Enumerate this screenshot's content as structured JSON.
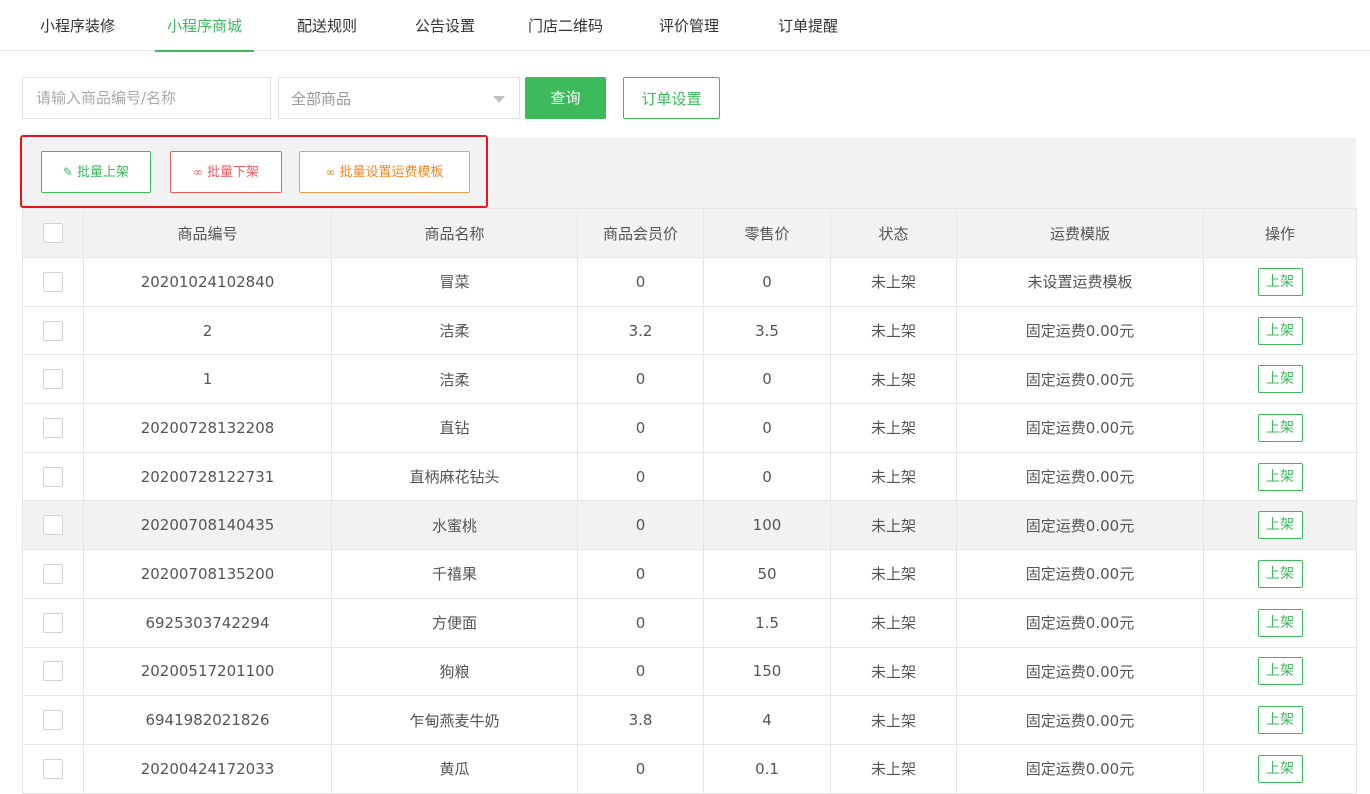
{
  "tabs": [
    {
      "label": "小程序装修"
    },
    {
      "label": "小程序商城"
    },
    {
      "label": "配送规则"
    },
    {
      "label": "公告设置"
    },
    {
      "label": "门店二维码"
    },
    {
      "label": "评价管理"
    },
    {
      "label": "订单提醒"
    }
  ],
  "active_tab": "小程序商城",
  "filters": {
    "search_placeholder": "请输入商品编号/名称",
    "search_value": "",
    "category_selected": "全部商品",
    "query_label": "查询",
    "order_settings_label": "订单设置"
  },
  "toolbar": {
    "batch_up_label": "批量上架",
    "batch_down_label": "批量下架",
    "batch_shipping_label": "批量设置运费模板"
  },
  "table": {
    "headers": [
      "商品编号",
      "商品名称",
      "商品会员价",
      "零售价",
      "状态",
      "运费模版",
      "操作"
    ],
    "rows": [
      {
        "code": "20201024102840",
        "name": "冒菜",
        "member_price": "0",
        "retail_price": "0",
        "status": "未上架",
        "shipping": "未设置运费模板",
        "action": "上架"
      },
      {
        "code": "2",
        "name": "洁柔",
        "member_price": "3.2",
        "retail_price": "3.5",
        "status": "未上架",
        "shipping": "固定运费0.00元",
        "action": "上架"
      },
      {
        "code": "1",
        "name": "洁柔",
        "member_price": "0",
        "retail_price": "0",
        "status": "未上架",
        "shipping": "固定运费0.00元",
        "action": "上架"
      },
      {
        "code": "20200728132208",
        "name": "直钻",
        "member_price": "0",
        "retail_price": "0",
        "status": "未上架",
        "shipping": "固定运费0.00元",
        "action": "上架"
      },
      {
        "code": "20200728122731",
        "name": "直柄麻花钻头",
        "member_price": "0",
        "retail_price": "0",
        "status": "未上架",
        "shipping": "固定运费0.00元",
        "action": "上架"
      },
      {
        "code": "20200708140435",
        "name": "水蜜桃",
        "member_price": "0",
        "retail_price": "100",
        "status": "未上架",
        "shipping": "固定运费0.00元",
        "action": "上架"
      },
      {
        "code": "20200708135200",
        "name": "千禧果",
        "member_price": "0",
        "retail_price": "50",
        "status": "未上架",
        "shipping": "固定运费0.00元",
        "action": "上架"
      },
      {
        "code": "6925303742294",
        "name": "方便面",
        "member_price": "0",
        "retail_price": "1.5",
        "status": "未上架",
        "shipping": "固定运费0.00元",
        "action": "上架"
      },
      {
        "code": "20200517201100",
        "name": "狗粮",
        "member_price": "0",
        "retail_price": "150",
        "status": "未上架",
        "shipping": "固定运费0.00元",
        "action": "上架"
      },
      {
        "code": "6941982021826",
        "name": "乍甸燕麦牛奶",
        "member_price": "3.8",
        "retail_price": "4",
        "status": "未上架",
        "shipping": "固定运费0.00元",
        "action": "上架"
      },
      {
        "code": "20200424172033",
        "name": "黄瓜",
        "member_price": "0",
        "retail_price": "0.1",
        "status": "未上架",
        "shipping": "固定运费0.00元",
        "action": "上架"
      }
    ]
  },
  "colors": {
    "accent": "#3dba5c",
    "danger": "#f05b5b",
    "warning": "#f08a24",
    "highlight_box": "#e8161c"
  }
}
